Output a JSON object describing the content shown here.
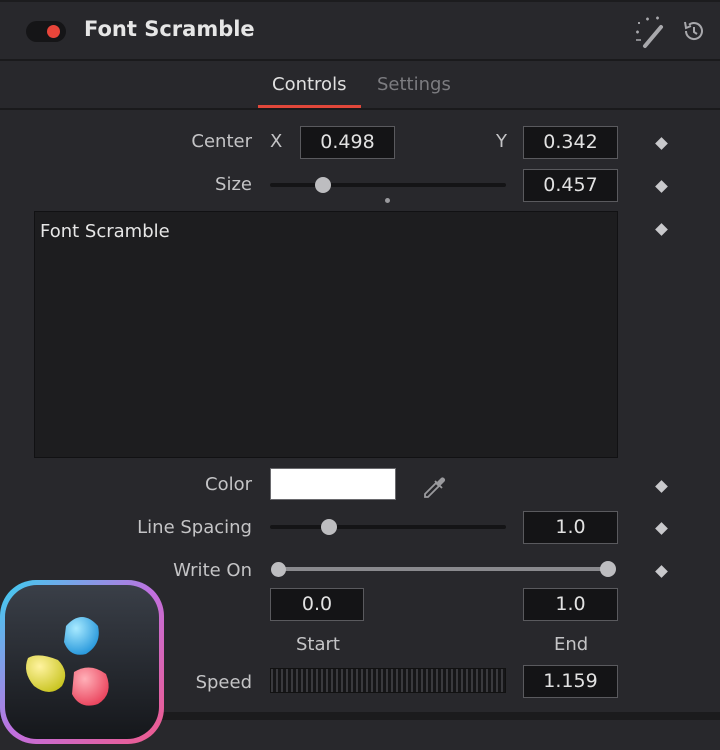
{
  "header": {
    "title": "Font Scramble"
  },
  "tabs": [
    {
      "label": "Controls",
      "active": true
    },
    {
      "label": "Settings",
      "active": false
    }
  ],
  "center": {
    "label": "Center",
    "x_label": "X",
    "x_value": "0.498",
    "y_label": "Y",
    "y_value": "0.342"
  },
  "size": {
    "label": "Size",
    "value": "0.457",
    "slider_fraction": 0.226
  },
  "text": {
    "value": "Font Scramble"
  },
  "color": {
    "label": "Color",
    "swatch": "#ffffff"
  },
  "line_spacing": {
    "label": "Line Spacing",
    "value": "1.0",
    "slider_fraction": 0.25
  },
  "write_on": {
    "label": "Write On",
    "start_value": "0.0",
    "end_value": "1.0",
    "start_label": "Start",
    "end_label": "End"
  },
  "speed": {
    "label": "Speed",
    "value": "1.159"
  },
  "colors": {
    "accent": "#e1473a",
    "background": "#28282c",
    "field": "#141416"
  },
  "icons": [
    "toggle-switch",
    "magic-wand-icon",
    "reset-icon",
    "keyframe-diamond-icon",
    "eyedropper-icon",
    "davinci-resolve-logo"
  ]
}
